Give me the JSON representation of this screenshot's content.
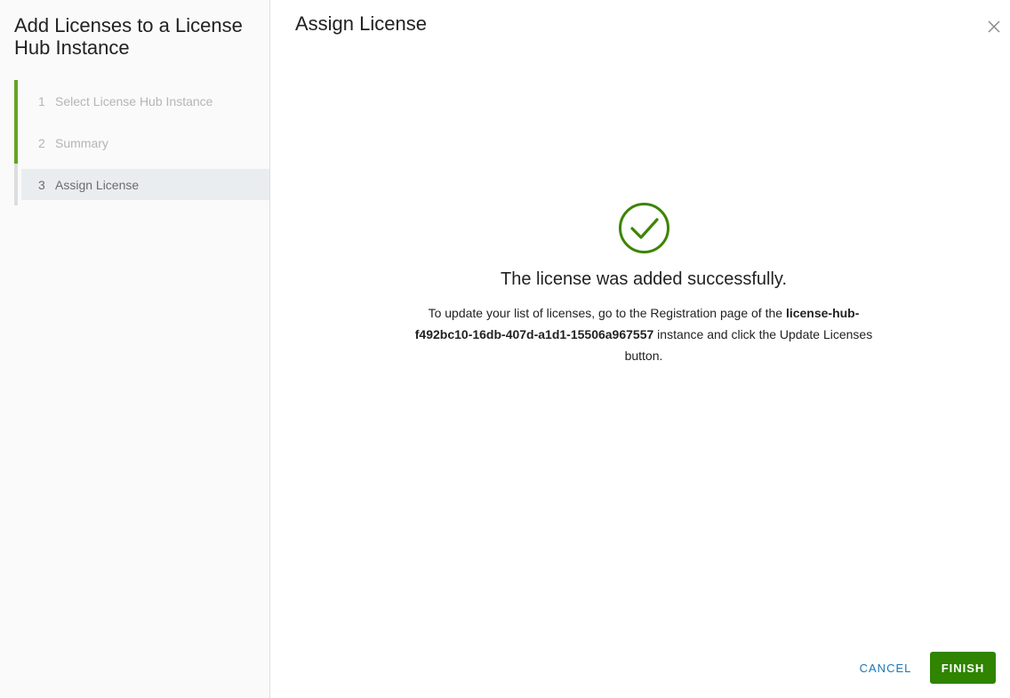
{
  "wizard": {
    "title": "Add Licenses to a License Hub Instance",
    "steps": [
      {
        "number": "1",
        "label": "Select License Hub Instance",
        "state": "done"
      },
      {
        "number": "2",
        "label": "Summary",
        "state": "done"
      },
      {
        "number": "3",
        "label": "Assign License",
        "state": "active"
      }
    ]
  },
  "main": {
    "title": "Assign License",
    "close_icon": "close-icon",
    "success": {
      "icon": "check-circle-icon",
      "heading": "The license was added successfully.",
      "message_prefix": "To update your list of licenses, go to the Registration page of the ",
      "instance_name": "license-hub-f492bc10-16db-407d-a1d1-15506a967557",
      "message_suffix": " instance and click the Update Licenses button."
    }
  },
  "footer": {
    "cancel_label": "CANCEL",
    "finish_label": "FINISH"
  },
  "colors": {
    "accent_green": "#62a420",
    "finish_green": "#2f8400",
    "check_green": "#3c8500",
    "link_blue": "#1c76b6"
  }
}
